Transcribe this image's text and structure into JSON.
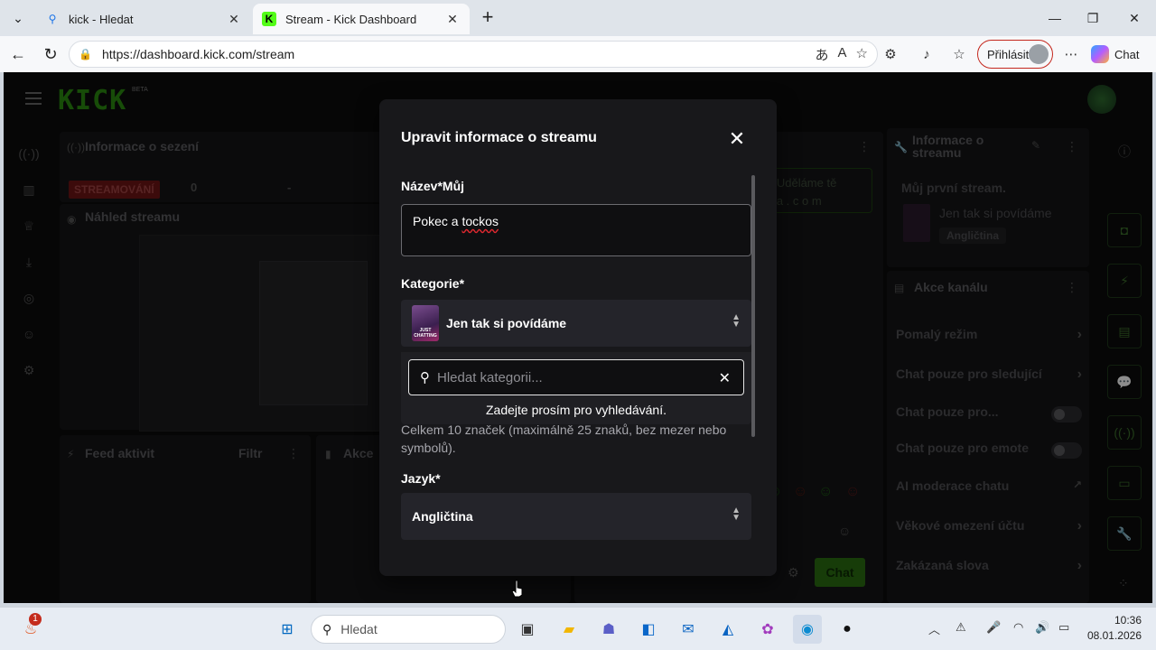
{
  "browser": {
    "tabs": [
      {
        "title": "kick - Hledat",
        "active": false
      },
      {
        "title": "Stream - Kick Dashboard",
        "active": true
      }
    ],
    "url": "https://dashboard.kick.com/stream",
    "login_label": "Přihlásit",
    "chat_label": "Chat"
  },
  "dashboard": {
    "logo": "KICK",
    "beta": "BETA",
    "session_title": "Informace o sezení",
    "live_badge": "STREAMOVÁNÍ",
    "stat_value": "0",
    "stat_dash": "-",
    "preview_title": "Náhled streamu",
    "feed_title": "Feed aktivit",
    "feed_filter": "Filtr",
    "actions_title_short": "Akce",
    "banner_text": "g Uděláme tě",
    "banner_text2": "n a . c o m",
    "chat_send": "Chat",
    "stream_info_title": "Informace o streamu",
    "stream_info_name": "Můj první stream.",
    "stream_info_category": "Jen tak si povídáme",
    "stream_info_language": "Angličtina",
    "channel_actions_title": "Akce kanálu",
    "channel_actions": [
      {
        "label": "Pomalý režim",
        "type": "arrow"
      },
      {
        "label": "Chat pouze pro sledující",
        "type": "arrow"
      },
      {
        "label": "Chat pouze pro...",
        "type": "toggle"
      },
      {
        "label": "Chat pouze pro emote",
        "type": "toggle"
      },
      {
        "label": "AI moderace chatu",
        "type": "external"
      },
      {
        "label": "Věkové omezení účtu",
        "type": "arrow"
      },
      {
        "label": "Zakázaná slova",
        "type": "arrow"
      }
    ]
  },
  "modal": {
    "title": "Upravit informace o streamu",
    "name_label": "Název*Můj",
    "name_value_a": "Pokec a ",
    "name_value_b": "tockos",
    "category_label": "Kategorie*",
    "category_value": "Jen tak si povídáme",
    "search_placeholder": "Hledat kategorii...",
    "search_hint": "Zadejte prosím pro vyhledávání.",
    "tags_helper": "Celkem 10 značek (maximálně 25 znaků, bez mezer nebo symbolů).",
    "language_label": "Jazyk*",
    "language_value": "Angličtina"
  },
  "taskbar": {
    "search_label": "Hledat",
    "time": "10:36",
    "date": "08.01.2026",
    "notification_count": "1"
  },
  "colors": {
    "kick_green": "#53fc18",
    "modal_bg": "#18181b",
    "live_red": "#6e1515"
  }
}
